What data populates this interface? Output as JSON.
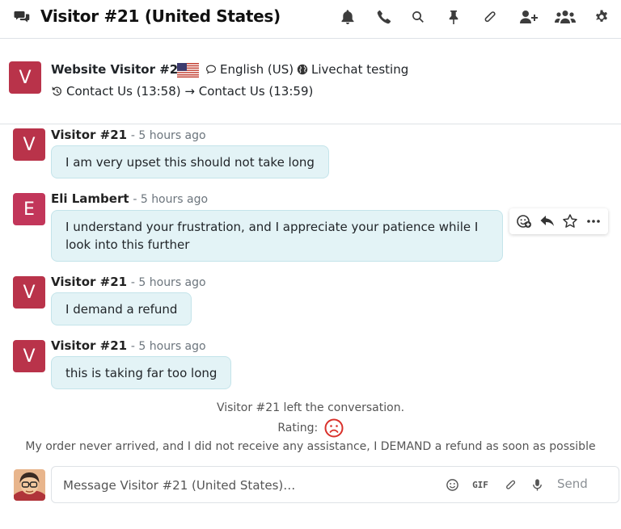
{
  "header": {
    "title": "Visitor #21 (United States)",
    "icons": [
      "chat-icon",
      "bell-icon",
      "phone-icon",
      "search-icon",
      "pin-icon",
      "paperclip-icon",
      "add-user-icon",
      "members-icon",
      "gear-icon"
    ]
  },
  "visitor": {
    "avatar_initial": "V",
    "name": "Website Visitor #21",
    "language": "English (US)",
    "website": "Livechat testing",
    "history": "Contact Us (13:58) → Contact Us (13:59)"
  },
  "messages": [
    {
      "avatar_initial": "V",
      "author": "Visitor #21",
      "time": "- 5 hours ago",
      "text": "I am very upset this should not take long"
    },
    {
      "avatar_initial": "E",
      "author": "Eli Lambert",
      "time": "- 5 hours ago",
      "text": "I understand your frustration, and I appreciate your patience while I look into this further"
    },
    {
      "avatar_initial": "V",
      "author": "Visitor #21",
      "time": "- 5 hours ago",
      "text": "I demand a refund"
    },
    {
      "avatar_initial": "V",
      "author": "Visitor #21",
      "time": "- 5 hours ago",
      "text": "this is taking far too long"
    }
  ],
  "message_actions": [
    "add-reaction-icon",
    "reply-icon",
    "star-icon",
    "more-icon"
  ],
  "notices": {
    "left": "Visitor #21 left the conversation.",
    "rating_label": "Rating:",
    "rating_value": "sad-face",
    "feedback": "My order never arrived, and I did not receive any assistance, I DEMAND a refund as soon as possible"
  },
  "composer": {
    "placeholder": "Message Visitor #21 (United States)…",
    "gif_label": "GIF",
    "send_label": "Send"
  },
  "colors": {
    "avatar_visitor": "#b9334a",
    "avatar_agent": "#c2365a",
    "bubble_bg": "#e3f3f6",
    "rating_red": "#d9312b"
  }
}
